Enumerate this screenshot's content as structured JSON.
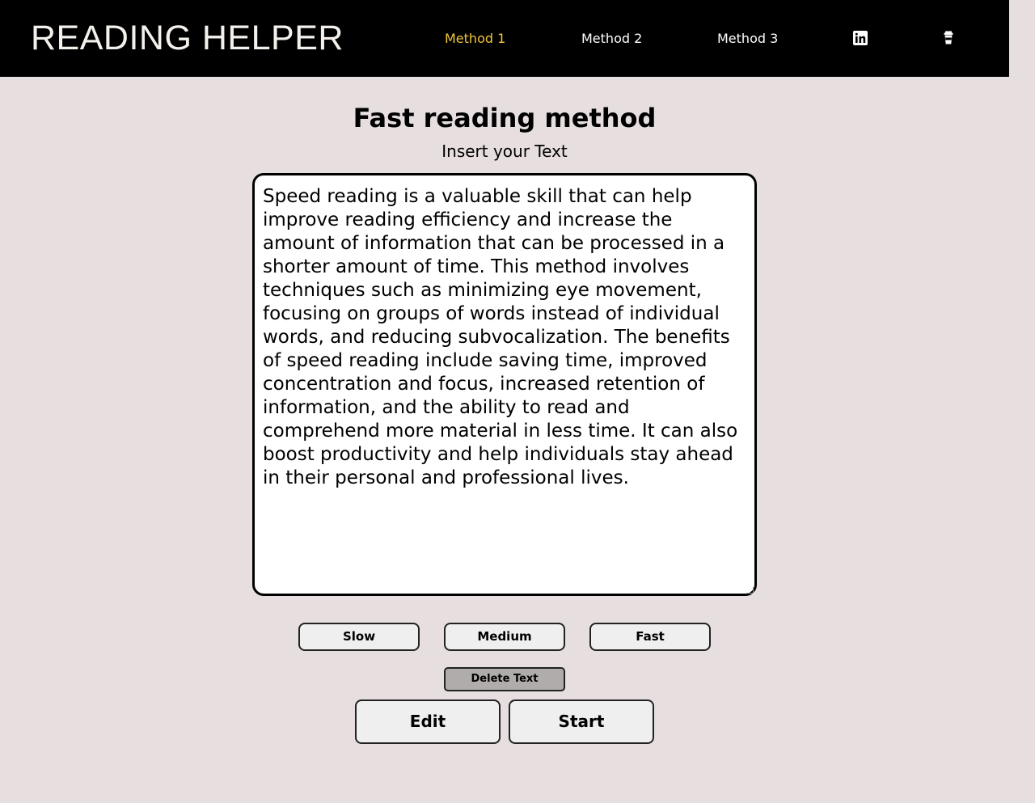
{
  "header": {
    "logo": "READING HELPER",
    "nav": [
      "Method 1",
      "Method 2",
      "Method 3"
    ],
    "active_index": 0,
    "icons": [
      "linkedin-icon",
      "coffee-cup-icon"
    ]
  },
  "main": {
    "title": "Fast reading method",
    "subtitle": "Insert your Text",
    "text_value": "Speed reading is a valuable skill that can help improve reading efficiency and increase the amount of information that can be processed in a shorter amount of time. This method involves techniques such as minimizing eye movement, focusing on groups of words instead of individual words, and reducing subvocalization. The benefits of speed reading include saving time, improved concentration and focus, increased retention of information, and the ability to read and comprehend more material in less time. It can also boost productivity and help individuals stay ahead in their personal and professional lives."
  },
  "controls": {
    "slow": "Slow",
    "medium": "Medium",
    "fast": "Fast",
    "delete": "Delete Text",
    "edit": "Edit",
    "start": "Start"
  },
  "colors": {
    "background": "#e6dedf",
    "navbar": "#000000",
    "active_link": "#f3c53a",
    "delete_button": "#b0acac"
  }
}
